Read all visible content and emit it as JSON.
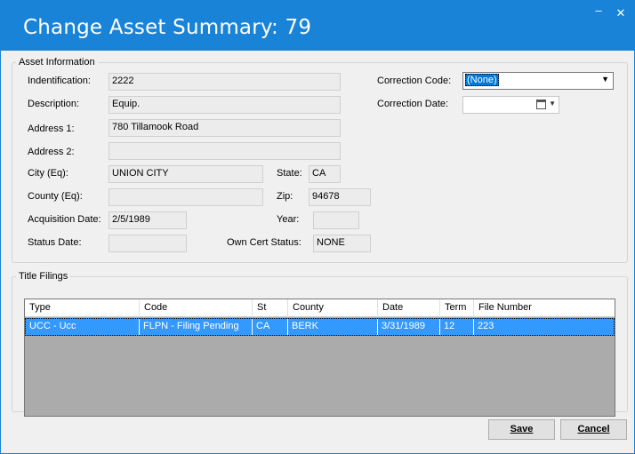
{
  "window": {
    "title": "Change Asset Summary: 79",
    "min_glyph": "–",
    "close_glyph": "✕"
  },
  "asset_info": {
    "legend": "Asset Information",
    "identification": {
      "label": "Indentification:",
      "value": "2222"
    },
    "description": {
      "label": "Description:",
      "value": "Equip."
    },
    "address1": {
      "label": "Address 1:",
      "value": "780 Tillamook Road"
    },
    "address2": {
      "label": "Address 2:",
      "value": ""
    },
    "city": {
      "label": "City (Eq):",
      "value": "UNION CITY"
    },
    "state": {
      "label": "State:",
      "value": "CA"
    },
    "county": {
      "label": "County (Eq):",
      "value": ""
    },
    "zip": {
      "label": "Zip:",
      "value": "94678"
    },
    "acquisition_date": {
      "label": "Acquisition Date:",
      "value": "2/5/1989"
    },
    "year": {
      "label": "Year:",
      "value": ""
    },
    "status_date": {
      "label": "Status Date:",
      "value": ""
    },
    "own_cert_status": {
      "label": "Own Cert Status:",
      "value": "NONE"
    },
    "correction_code": {
      "label": "Correction Code:",
      "value": "(None)"
    },
    "correction_date": {
      "label": "Correction Date:",
      "value": ""
    }
  },
  "title_filings": {
    "legend": "Title Filings",
    "columns": [
      "Type",
      "Code",
      "St",
      "County",
      "Date",
      "Term",
      "File Number"
    ],
    "rows": [
      [
        "UCC  - Ucc",
        "FLPN - Filing Pending",
        "CA",
        "BERK",
        "3/31/1989",
        "12",
        "223"
      ]
    ]
  },
  "buttons": {
    "save": "Save",
    "cancel": "Cancel"
  }
}
